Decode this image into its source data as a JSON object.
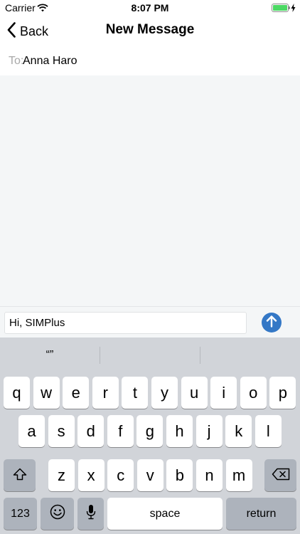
{
  "status_bar": {
    "carrier": "Carrier",
    "time": "8:07 PM",
    "battery_level": 1.0
  },
  "nav": {
    "back_label": "Back",
    "title": "New Message"
  },
  "recipient": {
    "label": "To:",
    "name": "Anna Haro"
  },
  "composer": {
    "value": "Hi, SIMPlus"
  },
  "keyboard": {
    "suggestions": [
      "“”",
      "",
      ""
    ],
    "row1": [
      "q",
      "w",
      "e",
      "r",
      "t",
      "y",
      "u",
      "i",
      "o",
      "p"
    ],
    "row2": [
      "a",
      "s",
      "d",
      "f",
      "g",
      "h",
      "j",
      "k",
      "l"
    ],
    "row3": [
      "z",
      "x",
      "c",
      "v",
      "b",
      "n",
      "m"
    ],
    "numbers_label": "123",
    "space_label": "space",
    "return_label": "return"
  }
}
